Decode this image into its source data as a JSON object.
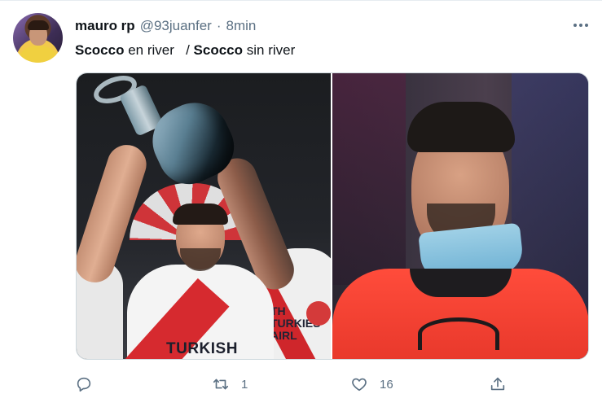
{
  "tweet": {
    "author": {
      "name": "mauro rp",
      "handle": "@93juanfer",
      "separator": "·",
      "time": "8min"
    },
    "text": {
      "part1_bold": "Scocco",
      "part1_rest": " en river",
      "spacer": "   / ",
      "part2_bold": "Scocco",
      "part2_rest": " sin river"
    },
    "media": {
      "left_jersey_text": "TURKISH",
      "left_mate_text": "TH\nTURKIES\nAIRL"
    },
    "actions": {
      "reply_icon": "reply-icon",
      "retweet_count": "1",
      "like_count": "16",
      "share_icon": "share-icon"
    }
  },
  "colors": {
    "text_primary": "#0f1419",
    "text_secondary": "#5b7083",
    "river_red": "#d62a2f",
    "bib_orange": "#ff4c3b"
  }
}
